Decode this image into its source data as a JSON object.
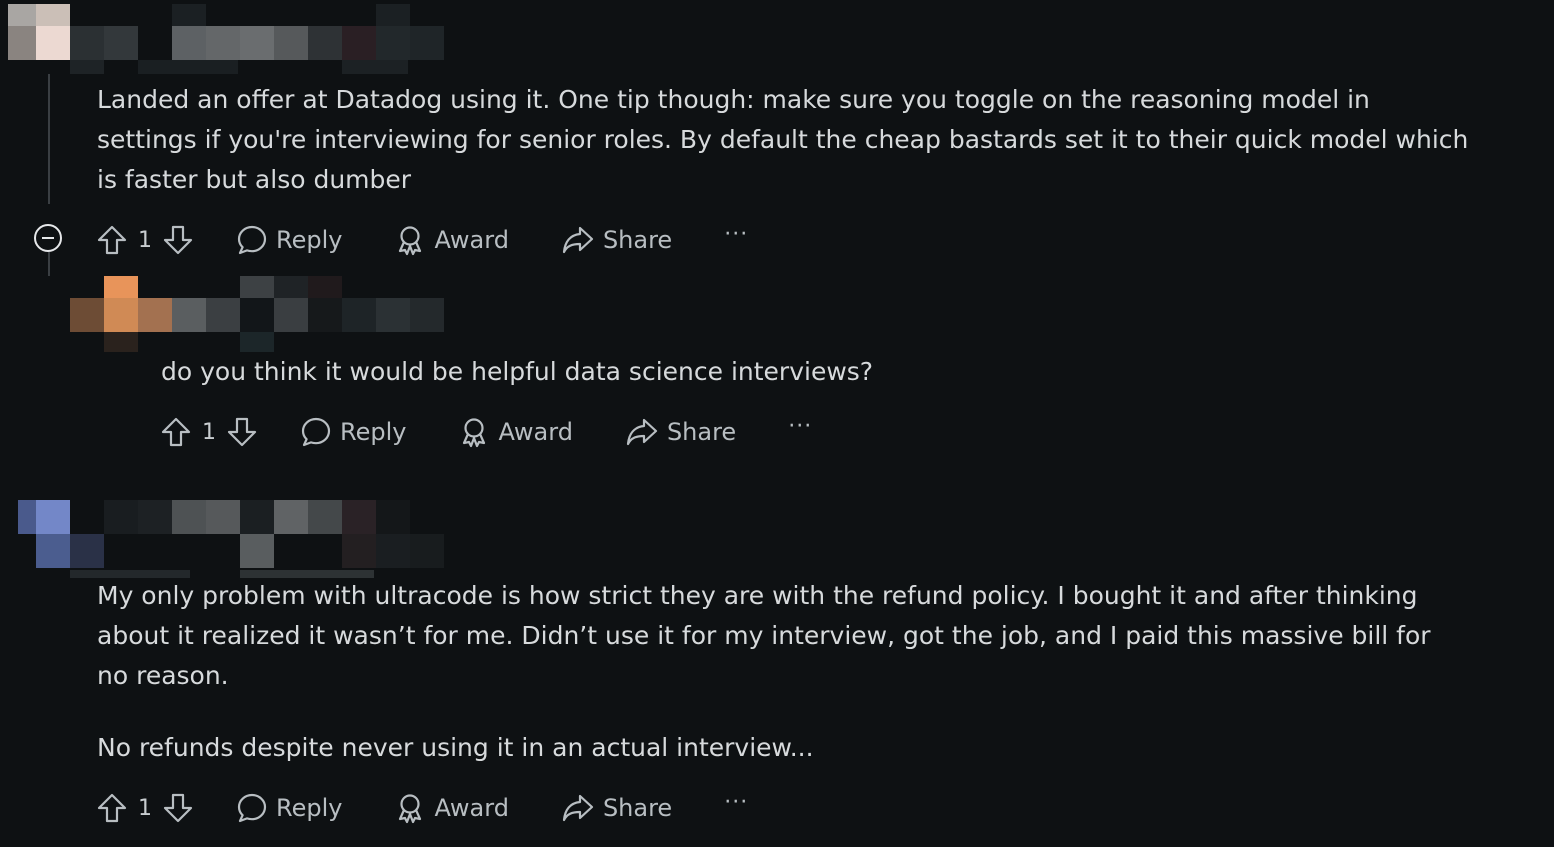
{
  "comments": [
    {
      "text": [
        "Landed an offer at Datadog using it. One tip though: make sure you toggle on the reasoning model in settings if you're interviewing for senior roles. By default the cheap bastards set it to their quick model which is faster but also dumber"
      ],
      "votes": "1",
      "reply_label": "Reply",
      "award_label": "Award",
      "share_label": "Share",
      "more_label": "···"
    },
    {
      "text": [
        "do you think it would be helpful data science interviews?"
      ],
      "votes": "1",
      "reply_label": "Reply",
      "award_label": "Award",
      "share_label": "Share",
      "more_label": "···"
    },
    {
      "text": [
        "My only problem with ultracode is how strict they are with the refund policy. I bought it and after thinking about it realized it wasn’t for me. Didn’t use it for my interview, got the job, and I paid this massive bill for no reason.",
        "No refunds despite never using it in an actual interview..."
      ],
      "votes": "1",
      "reply_label": "Reply",
      "award_label": "Award",
      "share_label": "Share",
      "more_label": "···"
    }
  ],
  "colors": {
    "background": "#0e1113",
    "text": "#d7dadc",
    "action": "#b8bec2"
  },
  "icons": [
    "upvote-icon",
    "downvote-icon",
    "comment-bubble-icon",
    "award-ribbon-icon",
    "share-arrow-icon",
    "collapse-minus-icon"
  ]
}
